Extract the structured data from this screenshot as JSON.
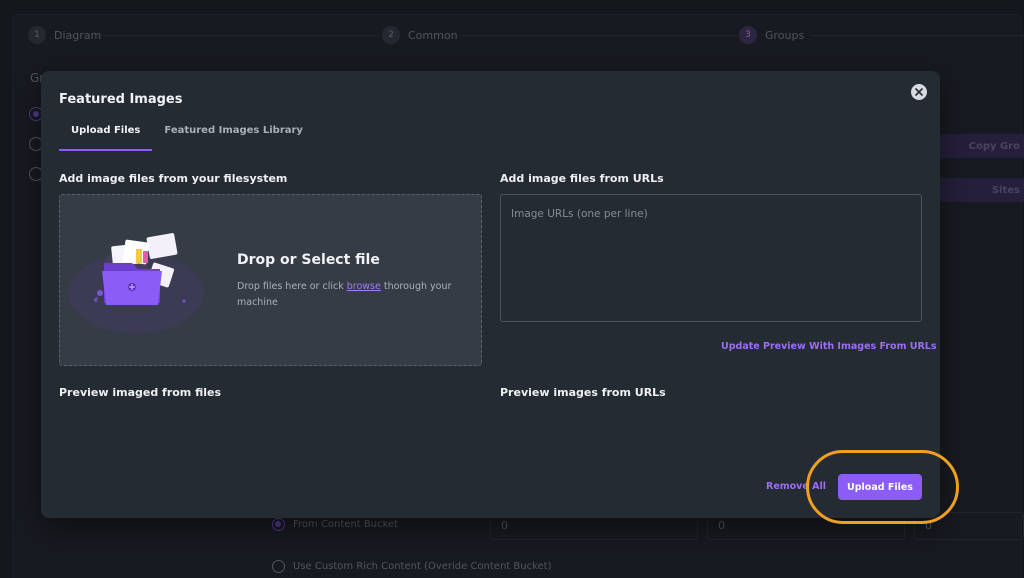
{
  "stepper": {
    "steps": [
      {
        "number": "1",
        "label": "Diagram"
      },
      {
        "number": "2",
        "label": "Common"
      },
      {
        "number": "3",
        "label": "Groups"
      }
    ]
  },
  "background": {
    "side_title": "Gr",
    "right_buttons": [
      "Copy Gro",
      "Sites"
    ],
    "bottom_options": [
      "From Content Bucket",
      "Use Custom Rich Content (Overide Content Bucket)"
    ],
    "select_values": [
      "0",
      "0",
      "0"
    ]
  },
  "modal": {
    "title": "Featured Images",
    "tabs": [
      "Upload Files",
      "Featured Images Library"
    ],
    "filesystem_label": "Add image files from your filesystem",
    "urls_label": "Add image files from URLs",
    "dropzone": {
      "title": "Drop or Select file",
      "text_before": "Drop files here or click ",
      "link": "browse",
      "text_after": " thorough your machine"
    },
    "url_placeholder": "Image URLs (one per line)",
    "update_preview_label": "Update Preview With Images From URLs",
    "preview_files_label": "Preview imaged from files",
    "preview_urls_label": "Preview images from URLs",
    "remove_all_label": "Remove All",
    "upload_label": "Upload Files"
  },
  "colors": {
    "accent": "#8b5cf6",
    "highlight": "#f0a020",
    "modal_bg": "#252b33"
  }
}
